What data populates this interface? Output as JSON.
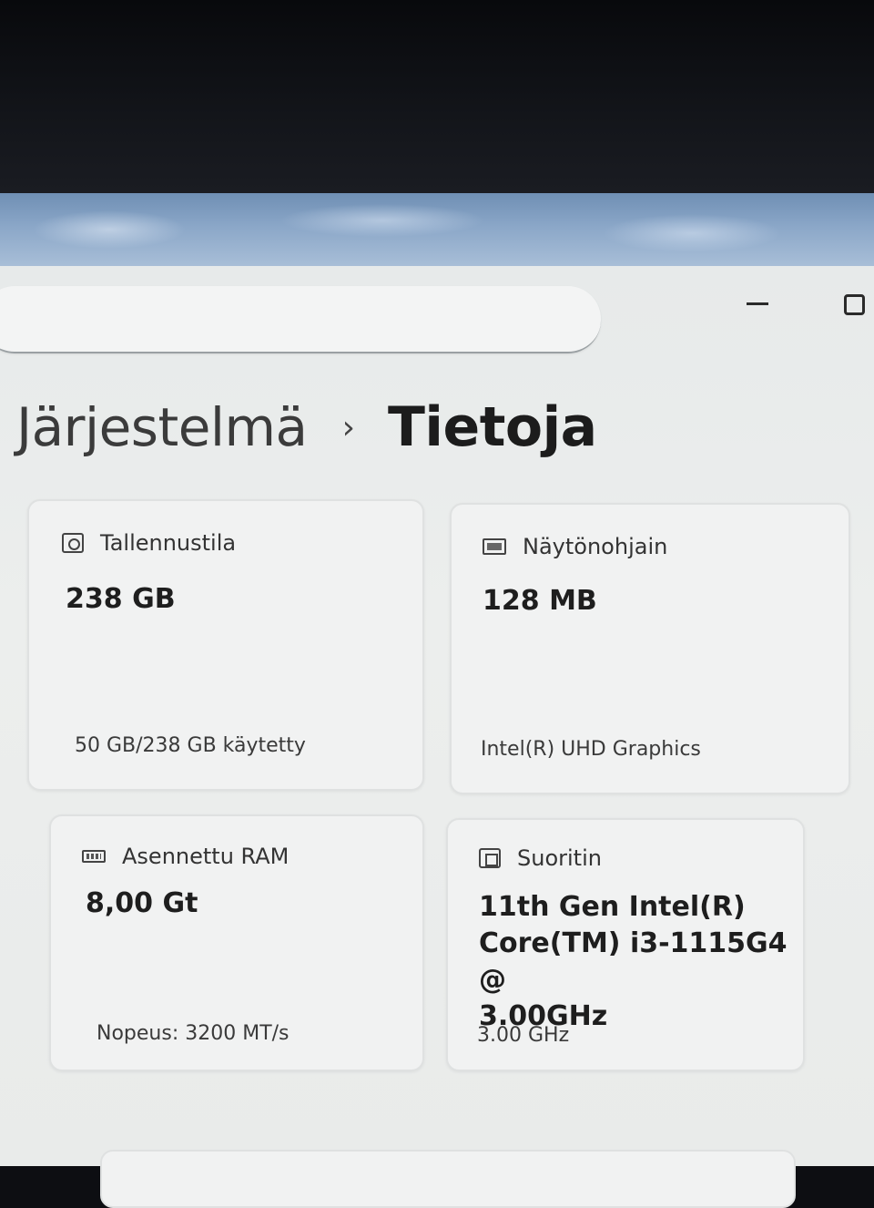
{
  "breadcrumb": {
    "parent": "Järjestelmä",
    "separator": "›",
    "current": "Tietoja"
  },
  "cards": {
    "storage": {
      "title": "Tallennustila",
      "value": "238 GB",
      "detail": "50 GB/238 GB käytetty",
      "icon": "storage-icon"
    },
    "gpu": {
      "title": "Näytönohjain",
      "value": "128 MB",
      "detail": "Intel(R) UHD Graphics",
      "icon": "display-adapter-icon"
    },
    "ram": {
      "title": "Asennettu RAM",
      "value": "8,00 Gt",
      "detail": "Nopeus: 3200 MT/s",
      "icon": "memory-icon"
    },
    "cpu": {
      "title": "Suoritin",
      "value_lines": [
        "11th Gen Intel(R)",
        "Core(TM) i3-1115G4 @",
        "3.00GHz"
      ],
      "detail": "3.00 GHz",
      "icon": "processor-icon"
    }
  }
}
